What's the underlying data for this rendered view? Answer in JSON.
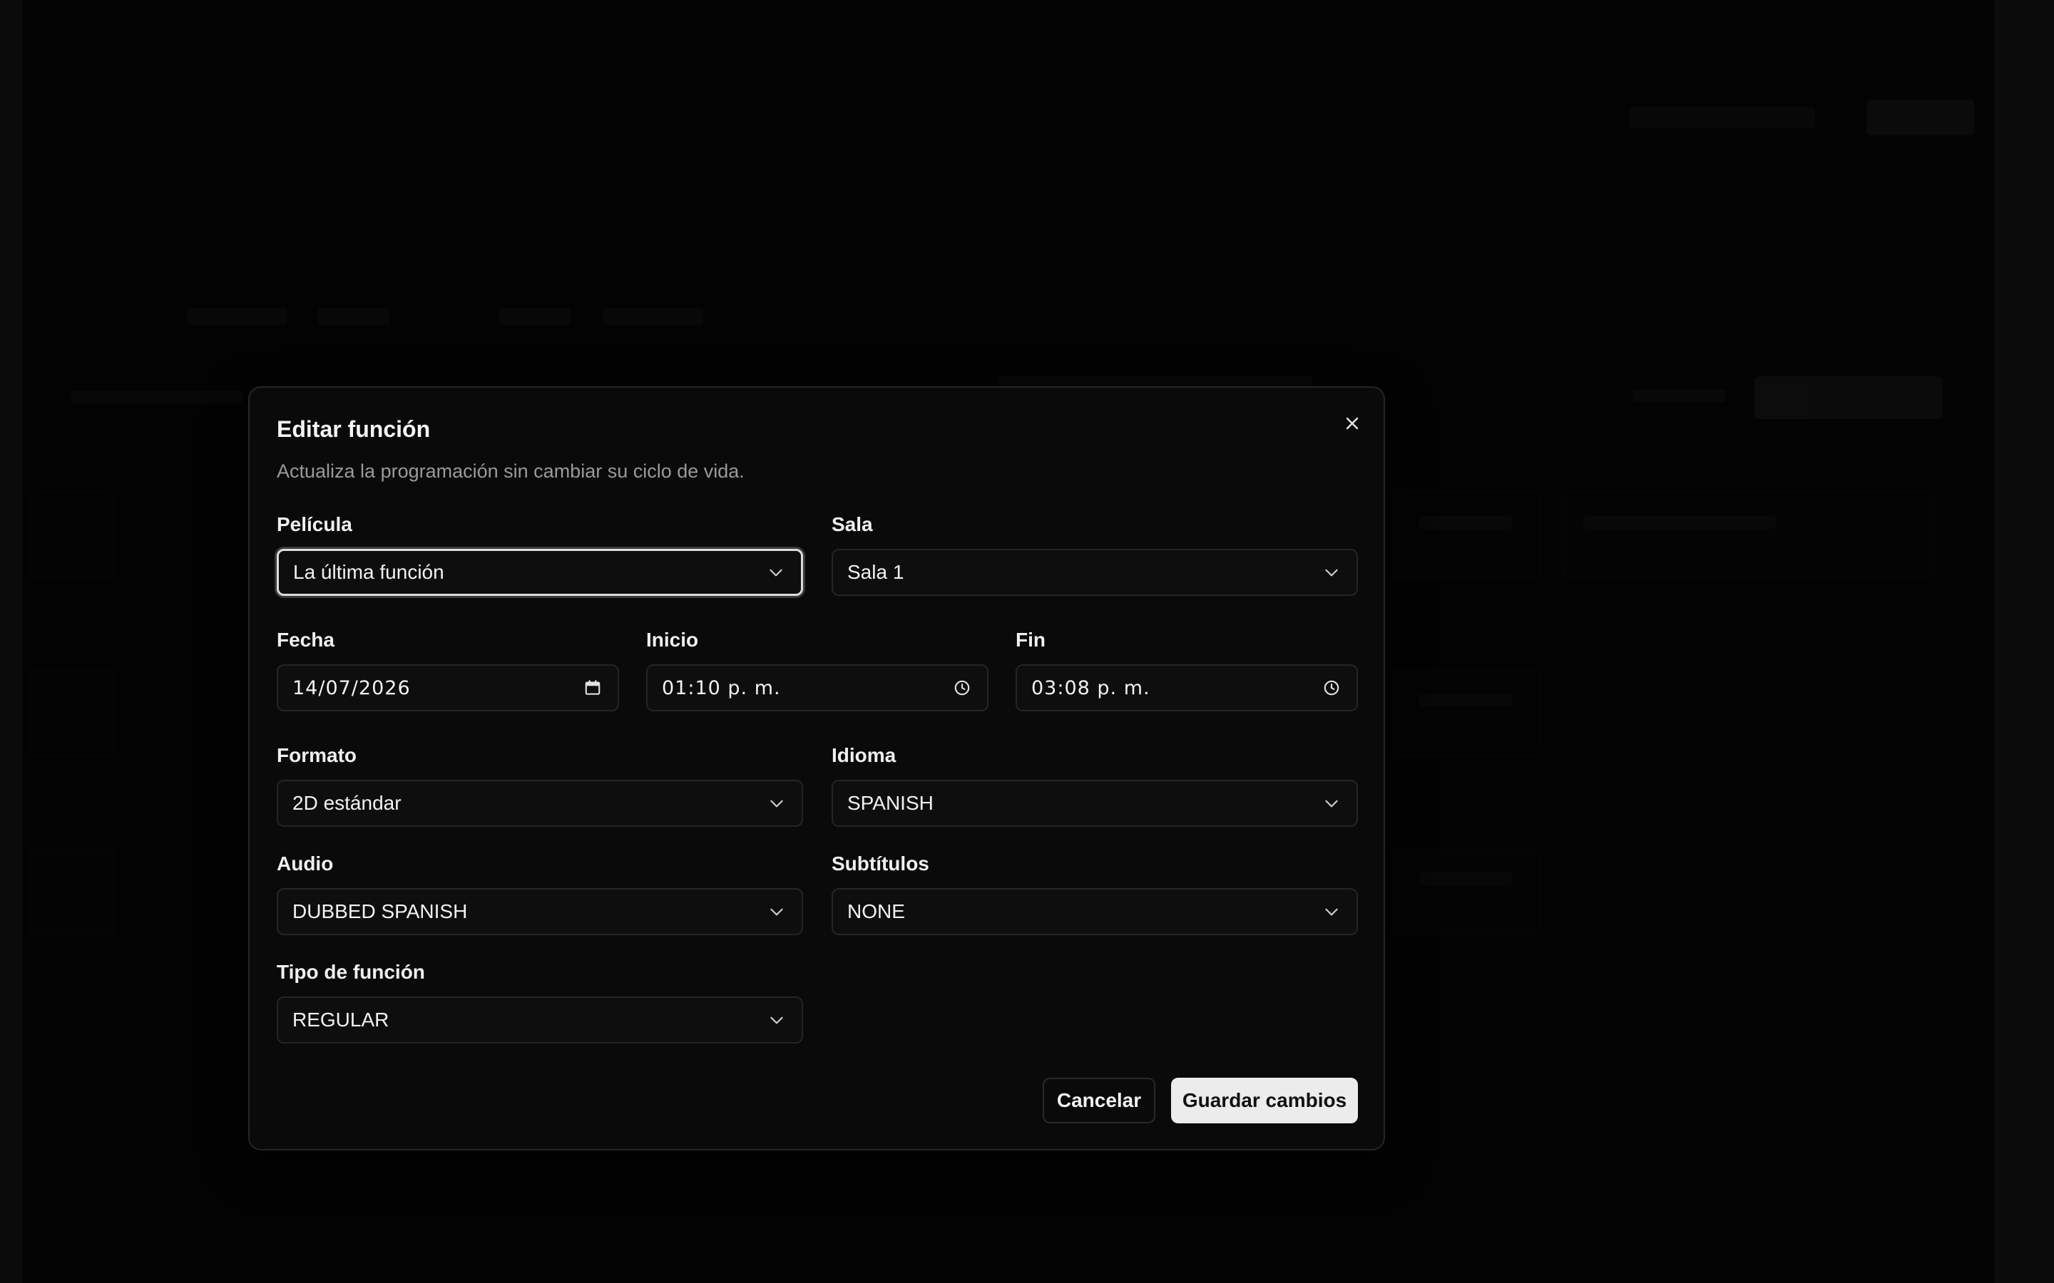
{
  "dialog": {
    "title": "Editar función",
    "subtitle": "Actualiza la programación sin cambiar su ciclo de vida."
  },
  "form": {
    "pelicula": {
      "label": "Película",
      "value": "La última función"
    },
    "sala": {
      "label": "Sala",
      "value": "Sala 1"
    },
    "fecha": {
      "label": "Fecha",
      "value": "14/07/2026"
    },
    "inicio": {
      "label": "Inicio",
      "value": "01:10 p. m."
    },
    "fin": {
      "label": "Fin",
      "value": "03:08 p. m."
    },
    "formato": {
      "label": "Formato",
      "value": "2D estándar"
    },
    "idioma": {
      "label": "Idioma",
      "value": "SPANISH"
    },
    "audio": {
      "label": "Audio",
      "value": "DUBBED SPANISH"
    },
    "subtitulos": {
      "label": "Subtítulos",
      "value": "NONE"
    },
    "tipo": {
      "label": "Tipo de función",
      "value": "REGULAR"
    }
  },
  "actions": {
    "cancel": "Cancelar",
    "save": "Guardar cambios"
  },
  "icons": {
    "close": "close-icon",
    "dropdown": "chevron-down-icon",
    "date": "calendar-icon",
    "time": "clock-icon"
  },
  "colors": {
    "background": "#030303",
    "dialog": "#0a0a0a",
    "primary_button": "#ececec"
  }
}
